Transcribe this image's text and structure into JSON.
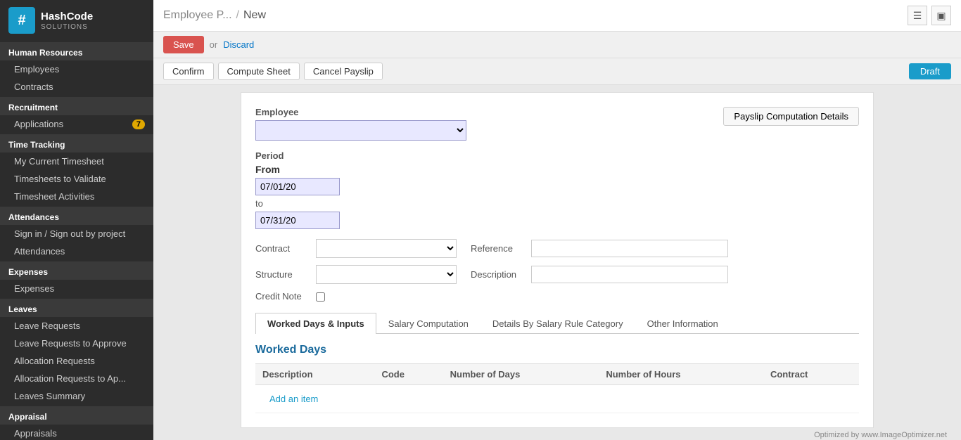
{
  "sidebar": {
    "logo": {
      "icon": "#",
      "name_part1": "Hash",
      "name_part2": "Code",
      "sub": "SOLUTIONS"
    },
    "sections": [
      {
        "header": "Human Resources",
        "items": [
          {
            "label": "Employees",
            "badge": null,
            "active": false
          },
          {
            "label": "Contracts",
            "badge": null,
            "active": false
          }
        ]
      },
      {
        "header": "Recruitment",
        "items": [
          {
            "label": "Applications",
            "badge": "7",
            "active": false
          }
        ]
      },
      {
        "header": "Time Tracking",
        "items": [
          {
            "label": "My Current Timesheet",
            "badge": null,
            "active": false
          },
          {
            "label": "Timesheets to Validate",
            "badge": null,
            "active": false
          },
          {
            "label": "Timesheet Activities",
            "badge": null,
            "active": false
          }
        ]
      },
      {
        "header": "Attendances",
        "items": [
          {
            "label": "Sign in / Sign out by project",
            "badge": null,
            "active": false
          },
          {
            "label": "Attendances",
            "badge": null,
            "active": false
          }
        ]
      },
      {
        "header": "Expenses",
        "items": [
          {
            "label": "Expenses",
            "badge": null,
            "active": false
          }
        ]
      },
      {
        "header": "Leaves",
        "items": [
          {
            "label": "Leave Requests",
            "badge": null,
            "active": false
          },
          {
            "label": "Leave Requests to Approve",
            "badge": null,
            "active": false
          },
          {
            "label": "Allocation Requests",
            "badge": null,
            "active": false
          },
          {
            "label": "Allocation Requests to Ap...",
            "badge": null,
            "active": false
          },
          {
            "label": "Leaves Summary",
            "badge": null,
            "active": false
          }
        ]
      },
      {
        "header": "Appraisal",
        "items": [
          {
            "label": "Appraisals",
            "badge": null,
            "active": false
          }
        ]
      }
    ]
  },
  "header": {
    "breadcrumb_parent": "Employee P...",
    "breadcrumb_sep": "/",
    "breadcrumb_current": "New"
  },
  "toolbar": {
    "save_label": "Save",
    "or_label": "or",
    "discard_label": "Discard"
  },
  "buttons": {
    "confirm": "Confirm",
    "compute_sheet": "Compute Sheet",
    "cancel_payslip": "Cancel Payslip",
    "draft": "Draft"
  },
  "form": {
    "employee_label": "Employee",
    "employee_value": "",
    "payslip_btn": "Payslip Computation Details",
    "period_label": "Period",
    "from_label": "From",
    "from_date": "07/01/20",
    "to_label": "to",
    "to_date": "07/31/20",
    "contract_label": "Contract",
    "contract_value": "",
    "reference_label": "Reference",
    "reference_value": "",
    "structure_label": "Structure",
    "structure_value": "",
    "description_label": "Description",
    "description_value": "",
    "credit_note_label": "Credit Note",
    "credit_note_checked": false
  },
  "tabs": {
    "items": [
      {
        "label": "Worked Days & Inputs",
        "active": true
      },
      {
        "label": "Salary Computation",
        "active": false
      },
      {
        "label": "Details By Salary Rule Category",
        "active": false
      },
      {
        "label": "Other Information",
        "active": false
      }
    ]
  },
  "worked_days": {
    "title": "Worked Days",
    "table": {
      "columns": [
        "Description",
        "Code",
        "Number of Days",
        "Number of Hours",
        "Contract"
      ],
      "rows": [],
      "add_item": "Add an item"
    }
  },
  "watermark": "Optimized by www.ImageOptimizer.net"
}
